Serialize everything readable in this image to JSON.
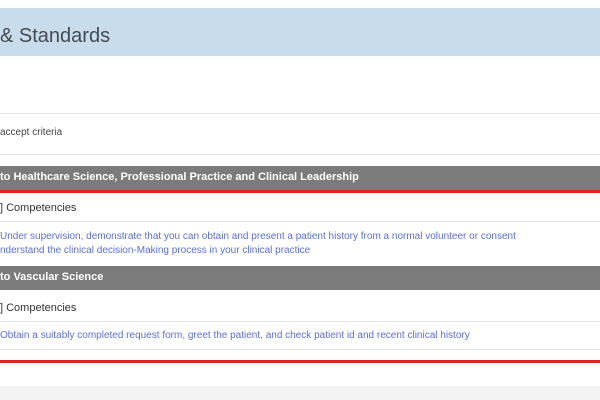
{
  "header": {
    "title": "& Standards"
  },
  "criteria": {
    "text": "accept criteria"
  },
  "sections": [
    {
      "title": "to Healthcare Science, Professional Practice and Clinical Leadership",
      "competencies_label": "] Competencies",
      "items": [
        "Under supervision, demonstrate that you can obtain and present a patient history from a normal volunteer or consent",
        "nderstand the clinical decision-Making process in your clinical practice"
      ]
    },
    {
      "title": "to Vascular Science",
      "competencies_label": "] Competencies",
      "items": [
        "Obtain a suitably completed request form, greet the patient, and check patient id and recent clinical history"
      ]
    }
  ],
  "colors": {
    "header_bg": "#c8dcec",
    "section_bar": "#7b7b7b",
    "highlight_line": "#e32020",
    "link": "#5b6fd6"
  }
}
